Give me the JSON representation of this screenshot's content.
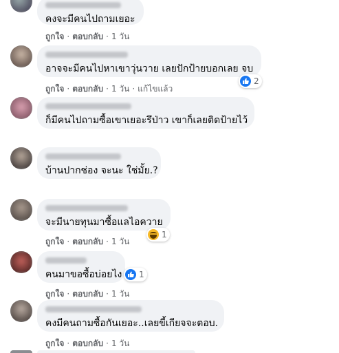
{
  "comments": [
    {
      "text": "คงจะมีคนไปถามเยอะ",
      "actions": [
        "ถูกใจ",
        "ตอบกลับ",
        "1 วัน"
      ]
    },
    {
      "text": "อาจจะมีคนไปหาเขาวุ่นวาย เลยปักป้ายบอกเลย จบ",
      "actions": [
        "ถูกใจ",
        "ตอบกลับ",
        "1 วัน",
        "แก้ไขแล้ว"
      ],
      "reaction": {
        "icon": "like-icon",
        "count": "2"
      }
    },
    {
      "text": "ก็มีคนไปถามซื้อเขาเยอะรึป่าว เขาก็เลยติดป้ายไว้"
    },
    {
      "text": "บ้านปากช่อง จะนะ ใช่มั้ย.?"
    },
    {
      "text": "จะมีนายทุนมาซื้อแลไอควาย",
      "actions": [
        "ถูกใจ",
        "ตอบกลับ",
        "1 วัน"
      ],
      "reaction": {
        "icon": "haha-icon",
        "count": "1"
      }
    },
    {
      "text": "คนมาขอซื้อบ่อยไง",
      "actions": [
        "ถูกใจ",
        "ตอบกลับ",
        "1 วัน"
      ],
      "reaction": {
        "icon": "like-icon",
        "count": "1"
      }
    },
    {
      "text": "คงมีคนถามซื้อกันเยอะ..เลยขี้เกียจจะตอบ.",
      "actions": [
        "ถูกใจ",
        "ตอบกลับ",
        "1 วัน"
      ]
    }
  ],
  "colors": {
    "bubble": "#f0f2f5",
    "meta_text": "#65676b",
    "like": "#1877f2",
    "haha": "#f7b928"
  }
}
